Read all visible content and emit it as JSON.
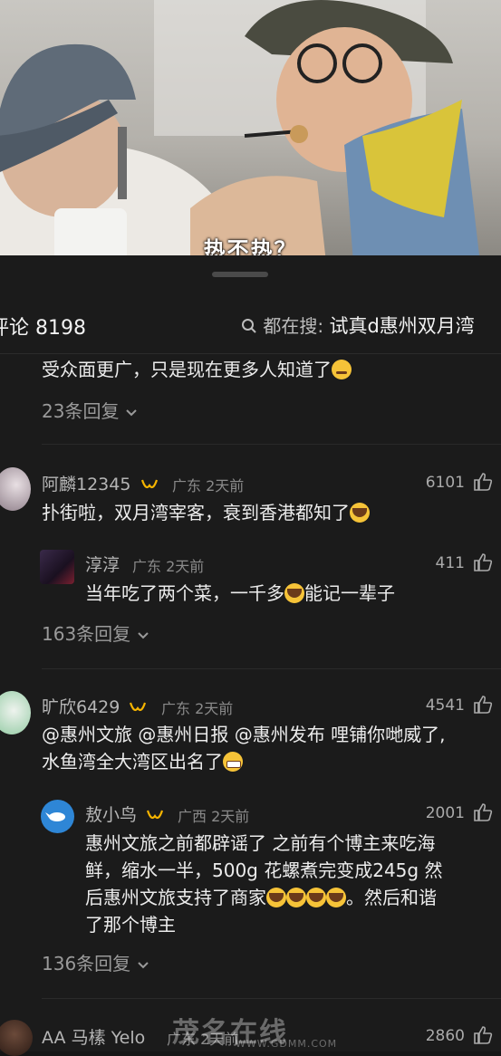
{
  "video": {
    "subtitle": "热不热？"
  },
  "header": {
    "title": "评论 8198",
    "search_prefix": "都在搜:",
    "search_keyword": "试真d惠州双月湾"
  },
  "top_partial": {
    "text": "受众面更广，只是现在更多人知道了",
    "replies": "23条回复"
  },
  "comments": [
    {
      "user": "阿麟12345",
      "location": "广东",
      "time": "2天前",
      "likes": "6101",
      "text": "扑街啦，双月湾宰客，衰到香港都知了"
    },
    {
      "user": "淳淳",
      "location": "广东",
      "time": "2天前",
      "likes": "411",
      "text": "当年吃了两个菜，一千多",
      "text_after": "能记一辈子"
    },
    {
      "replies": "163条回复"
    },
    {
      "user": "旷欣6429",
      "location": "广东",
      "time": "2天前",
      "likes": "4541",
      "line1": "@惠州文旅 @惠州日报 @惠州发布 哩铺你哋威了,",
      "line2": "水鱼湾全大湾区出名了"
    },
    {
      "user": "敖小鸟",
      "location": "广西",
      "time": "2天前",
      "likes": "2001",
      "line1": "惠州文旅之前都辟谣了 之前有个博主来吃海",
      "line2": "鲜，缩水一半，500g 花螺煮完变成245g 然",
      "line3": "后惠州文旅支持了商家",
      "line3_after": "。然后和谐",
      "line4": "了那个博主"
    },
    {
      "replies": "136条回复"
    },
    {
      "user": "AA 马榡 Yelo",
      "location": "广东",
      "time": "2天前",
      "likes": "2860"
    }
  ],
  "watermark": {
    "main": "茂名在线",
    "sub": "WWW.GDMM.COM"
  },
  "colors": {
    "bg": "#1b1b1b",
    "text": "#ececec",
    "muted": "#8a8a8a",
    "badge": "#f5b400"
  }
}
